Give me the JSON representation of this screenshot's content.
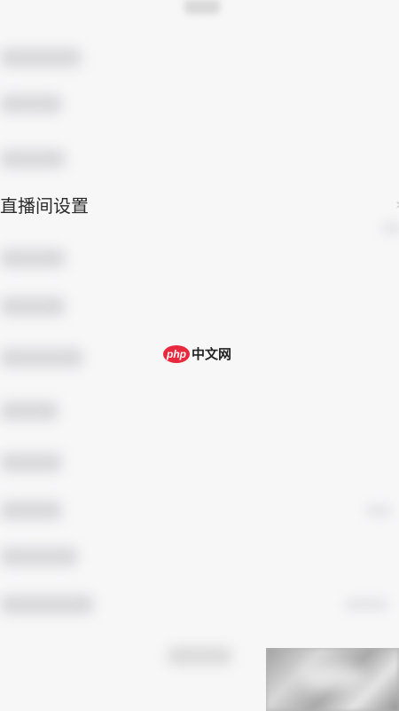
{
  "settings": {
    "live_room_settings_label": "直播间设置",
    "chevron_icon": "chevron-right-icon"
  },
  "watermark": {
    "logo_text": "php",
    "site_name": "中文网"
  },
  "colors": {
    "background": "#f7f7f8",
    "watermark_red": "#e8283c"
  }
}
